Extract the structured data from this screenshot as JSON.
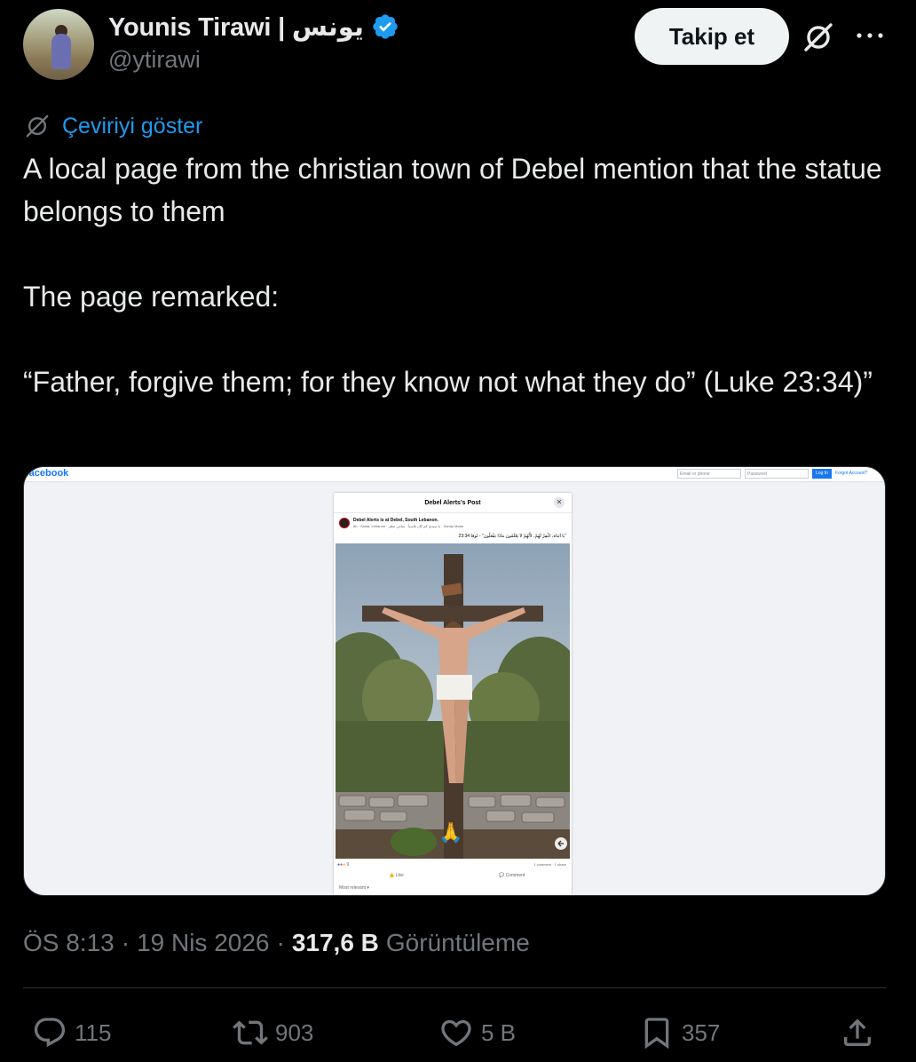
{
  "author": {
    "display_name": "Younis Tirawi | يونس",
    "handle": "@ytirawi",
    "verified": true
  },
  "header_actions": {
    "follow_label": "Takip et",
    "grok_icon": "grok-icon",
    "more_icon": "more-icon"
  },
  "translate": {
    "label": "Çeviriyi göster",
    "icon": "translate-icon"
  },
  "tweet": {
    "text": "A local page from the christian town of Debel mention that the statue belongs to them\n\nThe page remarked:\n\n“Father, forgive them; for they know not what they do” (Luke 23:34)”"
  },
  "media": {
    "facebook": {
      "logo": "facebook",
      "email_placeholder": "Email or phone",
      "password_placeholder": "Password",
      "login_label": "Log In",
      "forgot_label": "Forgot Account?",
      "post_title": "Debel Alerts's Post",
      "close_icon": "close-icon",
      "post_author": "Debel Alerts is at Debel, South Lebanon.",
      "post_meta": "6h · Saida, Lebanon · يا سيدي كم كان قاسياً · سامي مطر · Sandy Matar",
      "post_caption": "\"يا أبَتاه، اغْفِرْ لَهُمْ، لأَنَّهُمْ لاَ يَعْلَمُونَ مَاذَا يَفْعَلُونَ\" - لوقا 23:34",
      "reactions_count": "9",
      "stats": "1 comment · 1 share",
      "like_label": "Like",
      "comment_label": "Comment",
      "sort_label": "Most relevant ▾",
      "sign_text": "INRI",
      "emoji": "🙏"
    }
  },
  "meta": {
    "time": "ÖS 8:13",
    "separator": "·",
    "date": "19 Nis 2026",
    "views_count": "317,6 B",
    "views_label": "Görüntüleme"
  },
  "actions": {
    "replies": "115",
    "reposts": "903",
    "likes": "5 B",
    "bookmarks": "357"
  },
  "colors": {
    "background": "#000000",
    "text": "#e7e9ea",
    "muted": "#71767b",
    "link": "#1d9bf0",
    "verified": "#1d9bf0",
    "follow_bg": "#eff3f4"
  }
}
